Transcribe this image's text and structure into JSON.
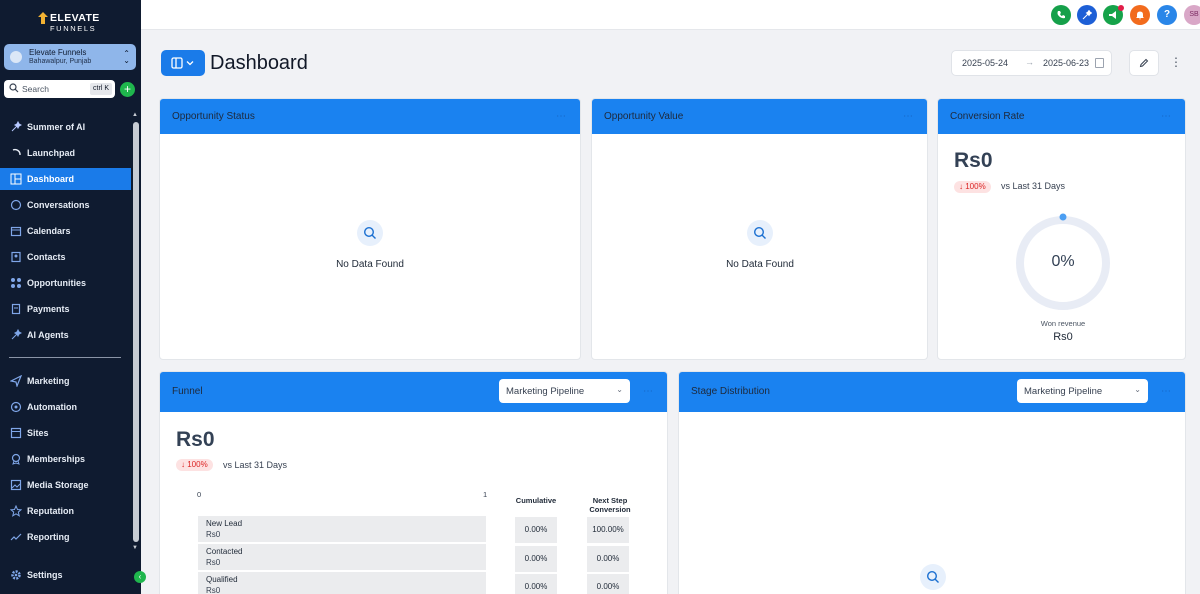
{
  "brand": {
    "name_line1": "ELEVATE",
    "name_line2": "FUNNELS"
  },
  "account": {
    "name": "Elevate Funnels",
    "location": "Bahawalpur, Punjab"
  },
  "search": {
    "placeholder": "Search",
    "shortcut": "ctrl K"
  },
  "sidebar": {
    "items": [
      {
        "label": "Summer of AI"
      },
      {
        "label": "Launchpad"
      },
      {
        "label": "Dashboard",
        "active": true
      },
      {
        "label": "Conversations"
      },
      {
        "label": "Calendars"
      },
      {
        "label": "Contacts"
      },
      {
        "label": "Opportunities"
      },
      {
        "label": "Payments"
      },
      {
        "label": "AI Agents"
      },
      {
        "label": "Marketing"
      },
      {
        "label": "Automation"
      },
      {
        "label": "Sites"
      },
      {
        "label": "Memberships"
      },
      {
        "label": "Media Storage"
      },
      {
        "label": "Reputation"
      },
      {
        "label": "Reporting"
      },
      {
        "label": "Settings"
      }
    ]
  },
  "topbar": {
    "avatar_initials": "SB"
  },
  "header": {
    "title": "Dashboard",
    "date_start": "2025-05-24",
    "date_end": "2025-06-23"
  },
  "cards": {
    "opportunity_status": {
      "title": "Opportunity Status",
      "empty": "No Data Found"
    },
    "opportunity_value": {
      "title": "Opportunity Value",
      "empty": "No Data Found"
    },
    "conversion_rate": {
      "title": "Conversion Rate",
      "amount": "Rs0",
      "change": "↓ 100%",
      "vs": "vs Last 31 Days",
      "percent": "0%",
      "gauge_label": "Won revenue",
      "gauge_value": "Rs0"
    },
    "funnel": {
      "title": "Funnel",
      "pipeline": "Marketing Pipeline",
      "amount": "Rs0",
      "change": "↓ 100%",
      "vs": "vs Last 31 Days",
      "axis_start": "0",
      "axis_end": "1",
      "col_cumulative": "Cumulative",
      "col_next_line1": "Next Step",
      "col_next_line2": "Conversion",
      "rows": [
        {
          "stage": "New Lead",
          "value": "Rs0",
          "cumulative": "0.00%",
          "next": "100.00%"
        },
        {
          "stage": "Contacted",
          "value": "Rs0",
          "cumulative": "0.00%",
          "next": "0.00%"
        },
        {
          "stage": "Qualified",
          "value": "Rs0",
          "cumulative": "0.00%",
          "next": "0.00%"
        }
      ]
    },
    "stage_distribution": {
      "title": "Stage Distribution",
      "pipeline": "Marketing Pipeline"
    }
  },
  "colors": {
    "primary": "#1a82f0",
    "sidebar_bg": "#0f1b30",
    "active": "#1a7be9",
    "negative": "#dc2626"
  }
}
